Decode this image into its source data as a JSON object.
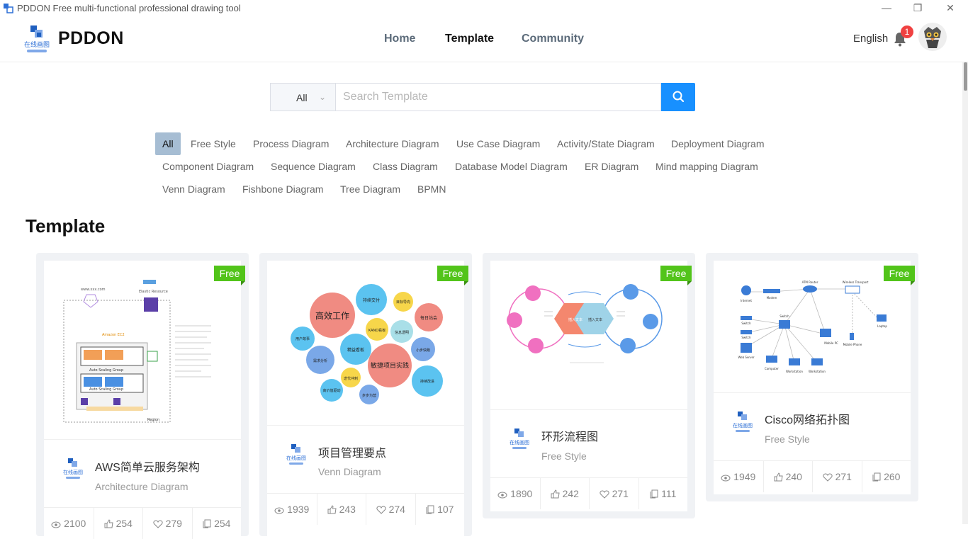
{
  "window": {
    "title": "PDDON Free multi-functional professional drawing tool"
  },
  "header": {
    "brand": "PDDON",
    "nav": [
      "Home",
      "Template",
      "Community"
    ],
    "language": "English",
    "notification_count": "1"
  },
  "search": {
    "scope": "All",
    "placeholder": "Search Template"
  },
  "categories": [
    "All",
    "Free Style",
    "Process Diagram",
    "Architecture Diagram",
    "Use Case Diagram",
    "Activity/State Diagram",
    "Deployment Diagram",
    "Component Diagram",
    "Sequence Diagram",
    "Class Diagram",
    "Database Model Diagram",
    "ER Diagram",
    "Mind mapping Diagram",
    "Venn Diagram",
    "Fishbone Diagram",
    "Tree Diagram",
    "BPMN"
  ],
  "section_title": "Template",
  "colors": {
    "accent": "#1890ff",
    "free_tag": "#52c41a",
    "active_cat": "#a6bdd3",
    "badge": "#f04141"
  },
  "cards": [
    {
      "tag": "Free",
      "name": "AWS简单云服务架构",
      "category": "Architecture Diagram",
      "views": "2100",
      "likes": "254",
      "favs": "279",
      "copies": "254"
    },
    {
      "tag": "Free",
      "name": "项目管理要点",
      "category": "Venn Diagram",
      "views": "1939",
      "likes": "243",
      "favs": "274",
      "copies": "107"
    },
    {
      "tag": "Free",
      "name": "环形流程图",
      "category": "Free Style",
      "views": "1890",
      "likes": "242",
      "favs": "271",
      "copies": "111"
    },
    {
      "tag": "Free",
      "name": "Cisco网络拓扑图",
      "category": "Free Style",
      "views": "1949",
      "likes": "240",
      "favs": "271",
      "copies": "260"
    }
  ],
  "thumbs": {
    "aws": {
      "labels": [
        "www.xxx.com",
        "Elastic Resource",
        "Amazon EC2",
        "Auto Scaling Group",
        "Auto Scaling Group",
        "Region"
      ]
    },
    "venn": {
      "labels": [
        "高效工作",
        "持续交付",
        "目标导向",
        "每日站会",
        "KANO看板",
        "信息透明",
        "用户故事",
        "精益看板",
        "敏捷项目实践",
        "小步快跑",
        "需求分析",
        "迭代冲刺",
        "持续改进",
        "高价值驱动",
        "步步为营"
      ]
    },
    "ring": {
      "labels": [
        "插入文本",
        "插入文本"
      ]
    },
    "cisco": {
      "labels": [
        "Internet",
        "Modem",
        "ATM Router",
        "Wireless Transport",
        "Switch",
        "Switch",
        "Switch",
        "Mobile PC",
        "Laptop",
        "Mobile Phone",
        "Web Server",
        "Computer",
        "Workstation",
        "Workstation"
      ]
    }
  }
}
